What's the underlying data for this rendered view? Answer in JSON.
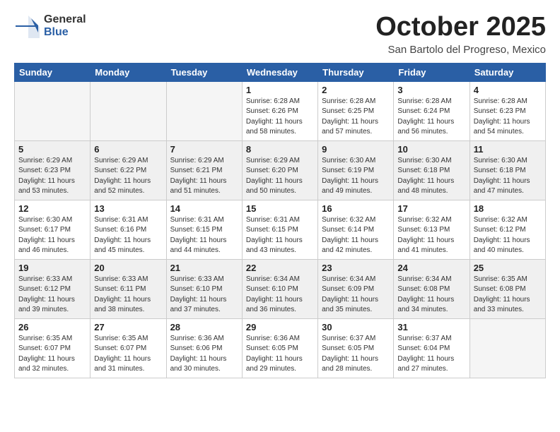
{
  "header": {
    "logo_general": "General",
    "logo_blue": "Blue",
    "month_title": "October 2025",
    "subtitle": "San Bartolo del Progreso, Mexico"
  },
  "days_of_week": [
    "Sunday",
    "Monday",
    "Tuesday",
    "Wednesday",
    "Thursday",
    "Friday",
    "Saturday"
  ],
  "weeks": [
    [
      {
        "day": "",
        "info": ""
      },
      {
        "day": "",
        "info": ""
      },
      {
        "day": "",
        "info": ""
      },
      {
        "day": "1",
        "info": "Sunrise: 6:28 AM\nSunset: 6:26 PM\nDaylight: 11 hours\nand 58 minutes."
      },
      {
        "day": "2",
        "info": "Sunrise: 6:28 AM\nSunset: 6:25 PM\nDaylight: 11 hours\nand 57 minutes."
      },
      {
        "day": "3",
        "info": "Sunrise: 6:28 AM\nSunset: 6:24 PM\nDaylight: 11 hours\nand 56 minutes."
      },
      {
        "day": "4",
        "info": "Sunrise: 6:28 AM\nSunset: 6:23 PM\nDaylight: 11 hours\nand 54 minutes."
      }
    ],
    [
      {
        "day": "5",
        "info": "Sunrise: 6:29 AM\nSunset: 6:23 PM\nDaylight: 11 hours\nand 53 minutes."
      },
      {
        "day": "6",
        "info": "Sunrise: 6:29 AM\nSunset: 6:22 PM\nDaylight: 11 hours\nand 52 minutes."
      },
      {
        "day": "7",
        "info": "Sunrise: 6:29 AM\nSunset: 6:21 PM\nDaylight: 11 hours\nand 51 minutes."
      },
      {
        "day": "8",
        "info": "Sunrise: 6:29 AM\nSunset: 6:20 PM\nDaylight: 11 hours\nand 50 minutes."
      },
      {
        "day": "9",
        "info": "Sunrise: 6:30 AM\nSunset: 6:19 PM\nDaylight: 11 hours\nand 49 minutes."
      },
      {
        "day": "10",
        "info": "Sunrise: 6:30 AM\nSunset: 6:18 PM\nDaylight: 11 hours\nand 48 minutes."
      },
      {
        "day": "11",
        "info": "Sunrise: 6:30 AM\nSunset: 6:18 PM\nDaylight: 11 hours\nand 47 minutes."
      }
    ],
    [
      {
        "day": "12",
        "info": "Sunrise: 6:30 AM\nSunset: 6:17 PM\nDaylight: 11 hours\nand 46 minutes."
      },
      {
        "day": "13",
        "info": "Sunrise: 6:31 AM\nSunset: 6:16 PM\nDaylight: 11 hours\nand 45 minutes."
      },
      {
        "day": "14",
        "info": "Sunrise: 6:31 AM\nSunset: 6:15 PM\nDaylight: 11 hours\nand 44 minutes."
      },
      {
        "day": "15",
        "info": "Sunrise: 6:31 AM\nSunset: 6:15 PM\nDaylight: 11 hours\nand 43 minutes."
      },
      {
        "day": "16",
        "info": "Sunrise: 6:32 AM\nSunset: 6:14 PM\nDaylight: 11 hours\nand 42 minutes."
      },
      {
        "day": "17",
        "info": "Sunrise: 6:32 AM\nSunset: 6:13 PM\nDaylight: 11 hours\nand 41 minutes."
      },
      {
        "day": "18",
        "info": "Sunrise: 6:32 AM\nSunset: 6:12 PM\nDaylight: 11 hours\nand 40 minutes."
      }
    ],
    [
      {
        "day": "19",
        "info": "Sunrise: 6:33 AM\nSunset: 6:12 PM\nDaylight: 11 hours\nand 39 minutes."
      },
      {
        "day": "20",
        "info": "Sunrise: 6:33 AM\nSunset: 6:11 PM\nDaylight: 11 hours\nand 38 minutes."
      },
      {
        "day": "21",
        "info": "Sunrise: 6:33 AM\nSunset: 6:10 PM\nDaylight: 11 hours\nand 37 minutes."
      },
      {
        "day": "22",
        "info": "Sunrise: 6:34 AM\nSunset: 6:10 PM\nDaylight: 11 hours\nand 36 minutes."
      },
      {
        "day": "23",
        "info": "Sunrise: 6:34 AM\nSunset: 6:09 PM\nDaylight: 11 hours\nand 35 minutes."
      },
      {
        "day": "24",
        "info": "Sunrise: 6:34 AM\nSunset: 6:08 PM\nDaylight: 11 hours\nand 34 minutes."
      },
      {
        "day": "25",
        "info": "Sunrise: 6:35 AM\nSunset: 6:08 PM\nDaylight: 11 hours\nand 33 minutes."
      }
    ],
    [
      {
        "day": "26",
        "info": "Sunrise: 6:35 AM\nSunset: 6:07 PM\nDaylight: 11 hours\nand 32 minutes."
      },
      {
        "day": "27",
        "info": "Sunrise: 6:35 AM\nSunset: 6:07 PM\nDaylight: 11 hours\nand 31 minutes."
      },
      {
        "day": "28",
        "info": "Sunrise: 6:36 AM\nSunset: 6:06 PM\nDaylight: 11 hours\nand 30 minutes."
      },
      {
        "day": "29",
        "info": "Sunrise: 6:36 AM\nSunset: 6:05 PM\nDaylight: 11 hours\nand 29 minutes."
      },
      {
        "day": "30",
        "info": "Sunrise: 6:37 AM\nSunset: 6:05 PM\nDaylight: 11 hours\nand 28 minutes."
      },
      {
        "day": "31",
        "info": "Sunrise: 6:37 AM\nSunset: 6:04 PM\nDaylight: 11 hours\nand 27 minutes."
      },
      {
        "day": "",
        "info": ""
      }
    ]
  ]
}
